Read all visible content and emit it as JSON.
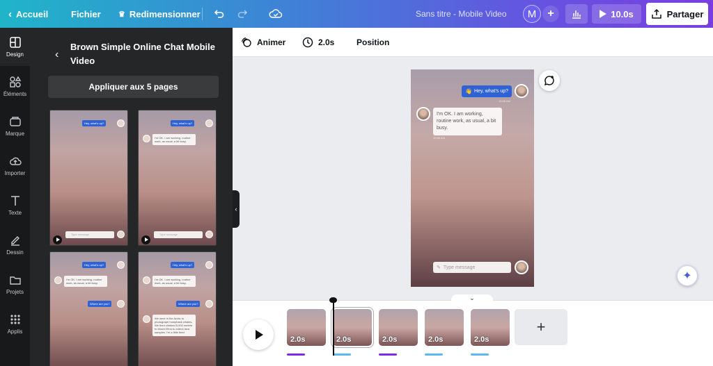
{
  "topbar": {
    "home_label": "Accueil",
    "file_label": "Fichier",
    "resize_label": "Redimensionner",
    "doc_title": "Sans titre - Mobile Video",
    "avatar_initial": "M",
    "play_duration": "10.0s",
    "share_label": "Partager"
  },
  "rail": {
    "items": [
      {
        "label": "Design",
        "icon": "design-icon"
      },
      {
        "label": "Éléments",
        "icon": "elements-icon"
      },
      {
        "label": "Marque",
        "icon": "brand-icon"
      },
      {
        "label": "Importer",
        "icon": "upload-icon"
      },
      {
        "label": "Texte",
        "icon": "text-icon"
      },
      {
        "label": "Dessin",
        "icon": "draw-icon"
      },
      {
        "label": "Projets",
        "icon": "folder-icon"
      },
      {
        "label": "Applis",
        "icon": "apps-icon"
      }
    ]
  },
  "panel": {
    "title": "Brown Simple Online Chat Mobile Video",
    "apply_label": "Appliquer aux 5 pages"
  },
  "toolbar": {
    "animate_label": "Animer",
    "duration_label": "2.0s",
    "position_label": "Position"
  },
  "chat": {
    "message_1": "Hey, what's up?",
    "time_1": "10:45 AM",
    "message_2": "I'm OK. I am working, routine work, as usual, a bit busy.",
    "time_2": "10:46 AM",
    "message_3": "Where are you?",
    "message_4": "We were in the Arctic to photograph humpback whales. We then climbed 5,000 meters to Mount Elna to collect lava samples. I'm a little tired",
    "input_placeholder": "Type message"
  },
  "timeline": {
    "clips": [
      {
        "duration": "2.0s",
        "bar_color": "#7d2ae8"
      },
      {
        "duration": "2.0s",
        "bar_color": "#5ab8f0"
      },
      {
        "duration": "2.0s",
        "bar_color": "#7d2ae8"
      },
      {
        "duration": "2.0s",
        "bar_color": "#5ab8f0"
      },
      {
        "duration": "2.0s",
        "bar_color": "#5ab8f0"
      }
    ],
    "add_label": "+"
  }
}
